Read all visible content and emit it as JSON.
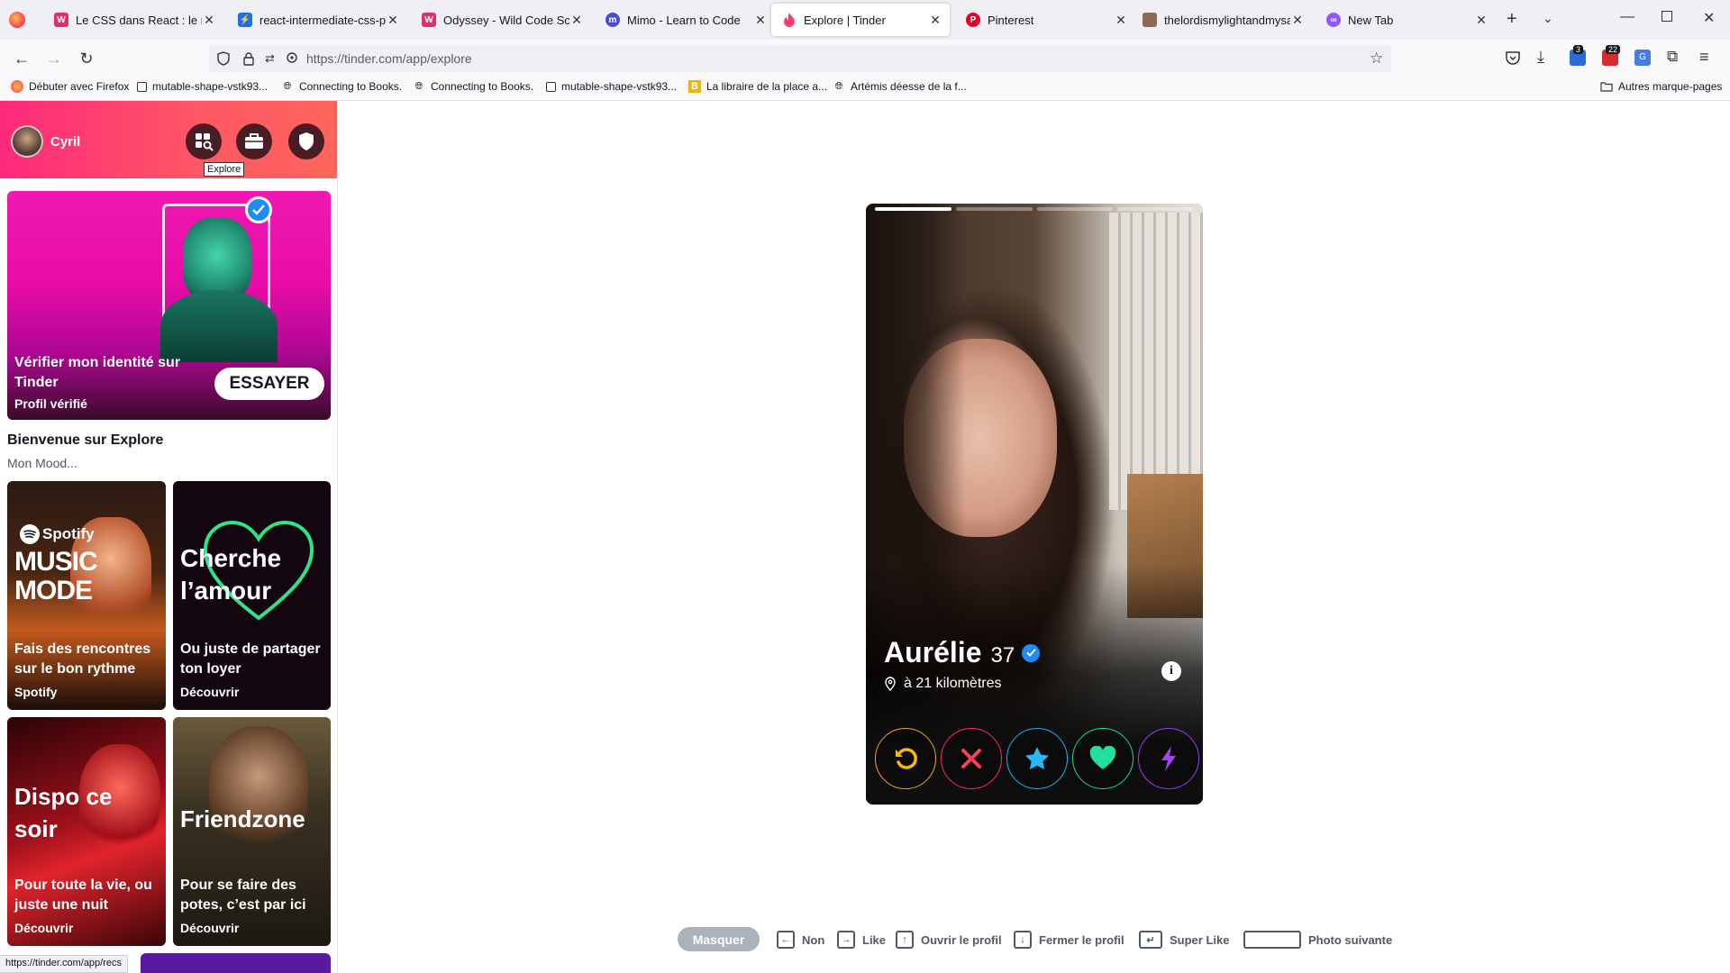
{
  "browser": {
    "tabs": [
      {
        "label": "Le CSS dans React : le n",
        "color": "#e2306c",
        "active": false
      },
      {
        "label": "react-intermediate-css-pre",
        "color": "#1f6feb",
        "active": false
      },
      {
        "label": "Odyssey - Wild Code Schoo",
        "color": "#e2306c",
        "active": false
      },
      {
        "label": "Mimo - Learn to Code",
        "color": "#4b4bd6",
        "active": false
      },
      {
        "label": "Explore | Tinder",
        "color": "#fe3c72",
        "active": true
      },
      {
        "label": "Pinterest",
        "color": "#e60023",
        "active": false
      },
      {
        "label": "thelordismylightandmysalv",
        "color": "#8a6b52",
        "active": false
      },
      {
        "label": "New Tab",
        "color": "#9059ff",
        "active": false
      }
    ],
    "url": "https://tinder.com/app/explore",
    "extension_badges": [
      "3",
      "22"
    ],
    "bookmarks": [
      {
        "label": "Débuter avec Firefox",
        "icon": "firefox-icon"
      },
      {
        "label": "mutable-shape-vstk93...",
        "icon": "page-icon"
      },
      {
        "label": "Connecting to Books.",
        "icon": "globe-icon"
      },
      {
        "label": "Connecting to Books.",
        "icon": "globe-icon"
      },
      {
        "label": "mutable-shape-vstk93...",
        "icon": "page-icon"
      },
      {
        "label": "La libraire de la place a...",
        "icon": "b-icon"
      },
      {
        "label": "Artémis déesse de la f...",
        "icon": "globe-icon"
      }
    ],
    "other_bookmarks": "Autres marque-pages",
    "status_url": "https://tinder.com/app/recs"
  },
  "sidebar": {
    "user_name": "Cyril",
    "tooltip": "Explore",
    "verify_card": {
      "title": "Vérifier mon identité sur Tinder",
      "subtitle": "Profil vérifié",
      "button": "ESSAYER"
    },
    "welcome_title": "Bienvenue sur Explore",
    "mood_label": "Mon Mood...",
    "cards": [
      {
        "headline_l1": "MUSIC",
        "headline_l2": "MODE",
        "brand": "Spotify",
        "title": "Fais des rencontres sur le bon rythme",
        "subtitle": "Spotify"
      },
      {
        "headline_l1": "Cherche",
        "headline_l2": "l’amour",
        "title": "Ou juste de partager ton loyer",
        "subtitle": "Découvrir"
      },
      {
        "headline_l1": "Dispo ce",
        "headline_l2": "soir",
        "title": "Pour toute la vie, ou juste une nuit",
        "subtitle": "Découvrir"
      },
      {
        "headline_l1": "Friendzone",
        "title": "Pour se faire des potes, c’est par ici",
        "subtitle": "Découvrir"
      }
    ]
  },
  "profile": {
    "name": "Aurélie",
    "age": "37",
    "distance": "à 21 kilomètres",
    "photo_count": 4,
    "current_photo": 1
  },
  "shortcuts": {
    "hide": "Masquer",
    "items": [
      "Non",
      "Like",
      "Ouvrir le profil",
      "Fermer le profil",
      "Super Like",
      "Photo suivante"
    ]
  }
}
